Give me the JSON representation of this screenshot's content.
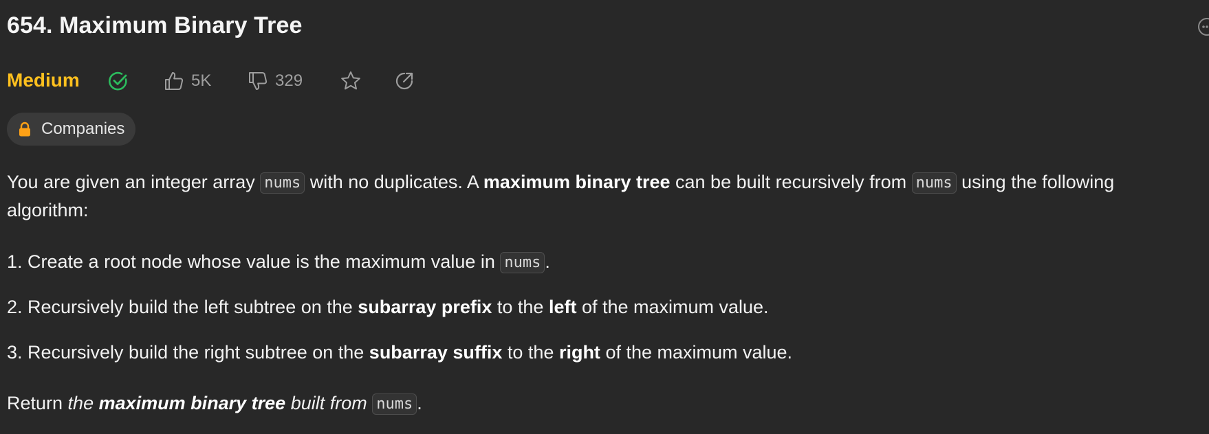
{
  "problem": {
    "title": "654. Maximum Binary Tree",
    "difficulty": "Medium",
    "likes": "5K",
    "dislikes": "329",
    "companies_label": "Companies"
  },
  "description": {
    "para1_a": "You are given an integer array ",
    "code_nums": "nums",
    "para1_b": " with no duplicates. A ",
    "para1_bold": "maximum binary tree",
    "para1_c": " can be built recursively from ",
    "para1_d": " using the following",
    "para1_line2": "algorithm:",
    "step1_a": "1. Create a root node whose value is the maximum value in ",
    "step1_b": ".",
    "step2_a": "2. Recursively build the left subtree on the ",
    "step2_bold1": "subarray prefix",
    "step2_b": " to the ",
    "step2_bold2": "left",
    "step2_c": " of the maximum value.",
    "step3_a": "3. Recursively build the right subtree on the ",
    "step3_bold1": "subarray suffix",
    "step3_b": " to the ",
    "step3_bold2": "right",
    "step3_c": " of the maximum value.",
    "return_a": "Return ",
    "return_italic": "the ",
    "return_bold": "maximum binary tree",
    "return_italic2": " built from ",
    "return_end": "."
  },
  "icons": {
    "solved": "check-circle-icon",
    "like": "thumbs-up-icon",
    "dislike": "thumbs-down-icon",
    "favorite": "star-icon",
    "share": "share-icon",
    "more": "more-icon",
    "lock": "lock-icon"
  },
  "colors": {
    "background": "#282828",
    "difficulty": "#ffc01e",
    "solved": "#2cbb5d",
    "muted": "#9e9e9e",
    "lock": "#ffa116"
  }
}
